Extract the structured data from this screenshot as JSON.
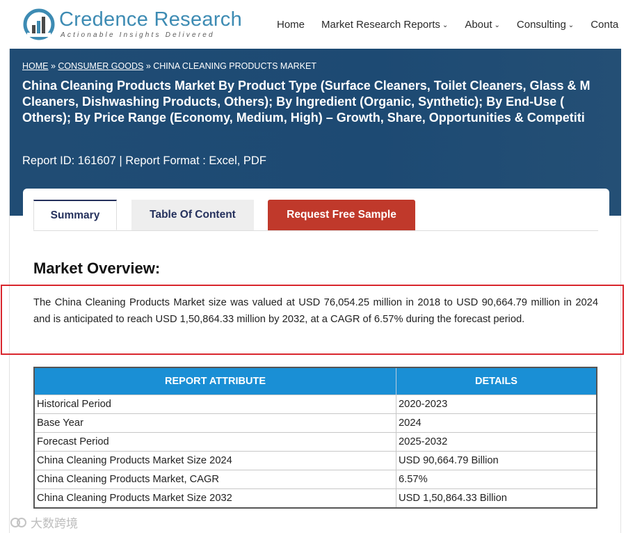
{
  "brand": {
    "name": "Credence Research",
    "tagline": "Actionable Insights Delivered",
    "colors": {
      "logo": "#3d8bb3",
      "banner": "#1f4b74",
      "accent_red": "#c0392b",
      "table_header": "#1a8fd5",
      "highlight_box": "#d9262d"
    }
  },
  "nav": {
    "items": [
      {
        "label": "Home",
        "dropdown": false
      },
      {
        "label": "Market Research Reports",
        "dropdown": true
      },
      {
        "label": "About",
        "dropdown": true
      },
      {
        "label": "Consulting",
        "dropdown": true
      },
      {
        "label": "Conta",
        "dropdown": false
      }
    ],
    "chevron": "⌄"
  },
  "breadcrumb": {
    "home": "HOME",
    "sep": " » ",
    "category": "CONSUMER GOODS",
    "current": "CHINA CLEANING PRODUCTS MARKET"
  },
  "title_lines": [
    "China Cleaning Products Market By Product Type (Surface Cleaners, Toilet Cleaners, Glass & M",
    "Cleaners, Dishwashing Products, Others); By Ingredient (Organic, Synthetic); By End-Use (",
    "Others); By Price Range (Economy, Medium, High) – Growth, Share, Opportunities & Competiti"
  ],
  "report_meta": "Report ID: 161607 | Report Format : Excel, PDF",
  "tabs": [
    {
      "label": "Summary",
      "active": true
    },
    {
      "label": "Table Of Content",
      "active": false
    },
    {
      "label": "Request Free Sample",
      "active": false
    }
  ],
  "overview": {
    "heading": "Market Overview:",
    "text": "The China Cleaning Products Market size was valued at USD 76,054.25 million in 2018 to USD 90,664.79 million in 2024 and is anticipated to reach USD  1,50,864.33 million by 2032, at a CAGR of 6.57% during the forecast period."
  },
  "table": {
    "headers": [
      "REPORT ATTRIBUTE",
      "DETAILS"
    ],
    "rows": [
      [
        "Historical Period",
        "2020-2023"
      ],
      [
        "Base Year",
        "2024"
      ],
      [
        "Forecast Period",
        "2025-2032"
      ],
      [
        "China Cleaning Products Market Size 2024",
        "USD 90,664.79 Billion"
      ],
      [
        "China Cleaning Products Market, CAGR",
        "6.57%"
      ],
      [
        "China Cleaning Products Market Size 2032",
        "USD 1,50,864.33 Billion"
      ]
    ]
  },
  "watermark": "大数跨境"
}
